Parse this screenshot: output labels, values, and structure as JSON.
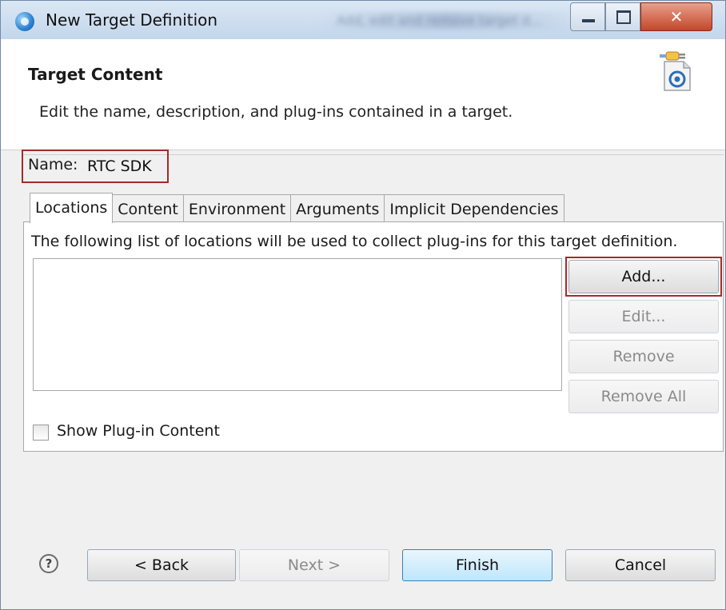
{
  "window": {
    "title": "New Target Definition",
    "background_title": "Add, edit and remove target d..."
  },
  "header": {
    "title": "Target Content",
    "description": "Edit the name, description, and plug-ins contained in a target."
  },
  "name_field": {
    "label": "Name:",
    "value": "RTC SDK"
  },
  "tabs": [
    {
      "label": "Locations"
    },
    {
      "label": "Content"
    },
    {
      "label": "Environment"
    },
    {
      "label": "Arguments"
    },
    {
      "label": "Implicit Dependencies"
    }
  ],
  "locations": {
    "description": "The following list of locations will be used to collect plug-ins for this target definition.",
    "buttons": {
      "add": "Add...",
      "edit": "Edit...",
      "remove": "Remove",
      "remove_all": "Remove All"
    },
    "show_plugin_content": {
      "label": "Show Plug-in Content",
      "checked": false
    }
  },
  "footer": {
    "help_glyph": "?",
    "back": "< Back",
    "next": "Next >",
    "finish": "Finish",
    "cancel": "Cancel"
  },
  "colors": {
    "highlight_frame": "#a52a2a",
    "finish_accent": "#3c7fb1"
  }
}
